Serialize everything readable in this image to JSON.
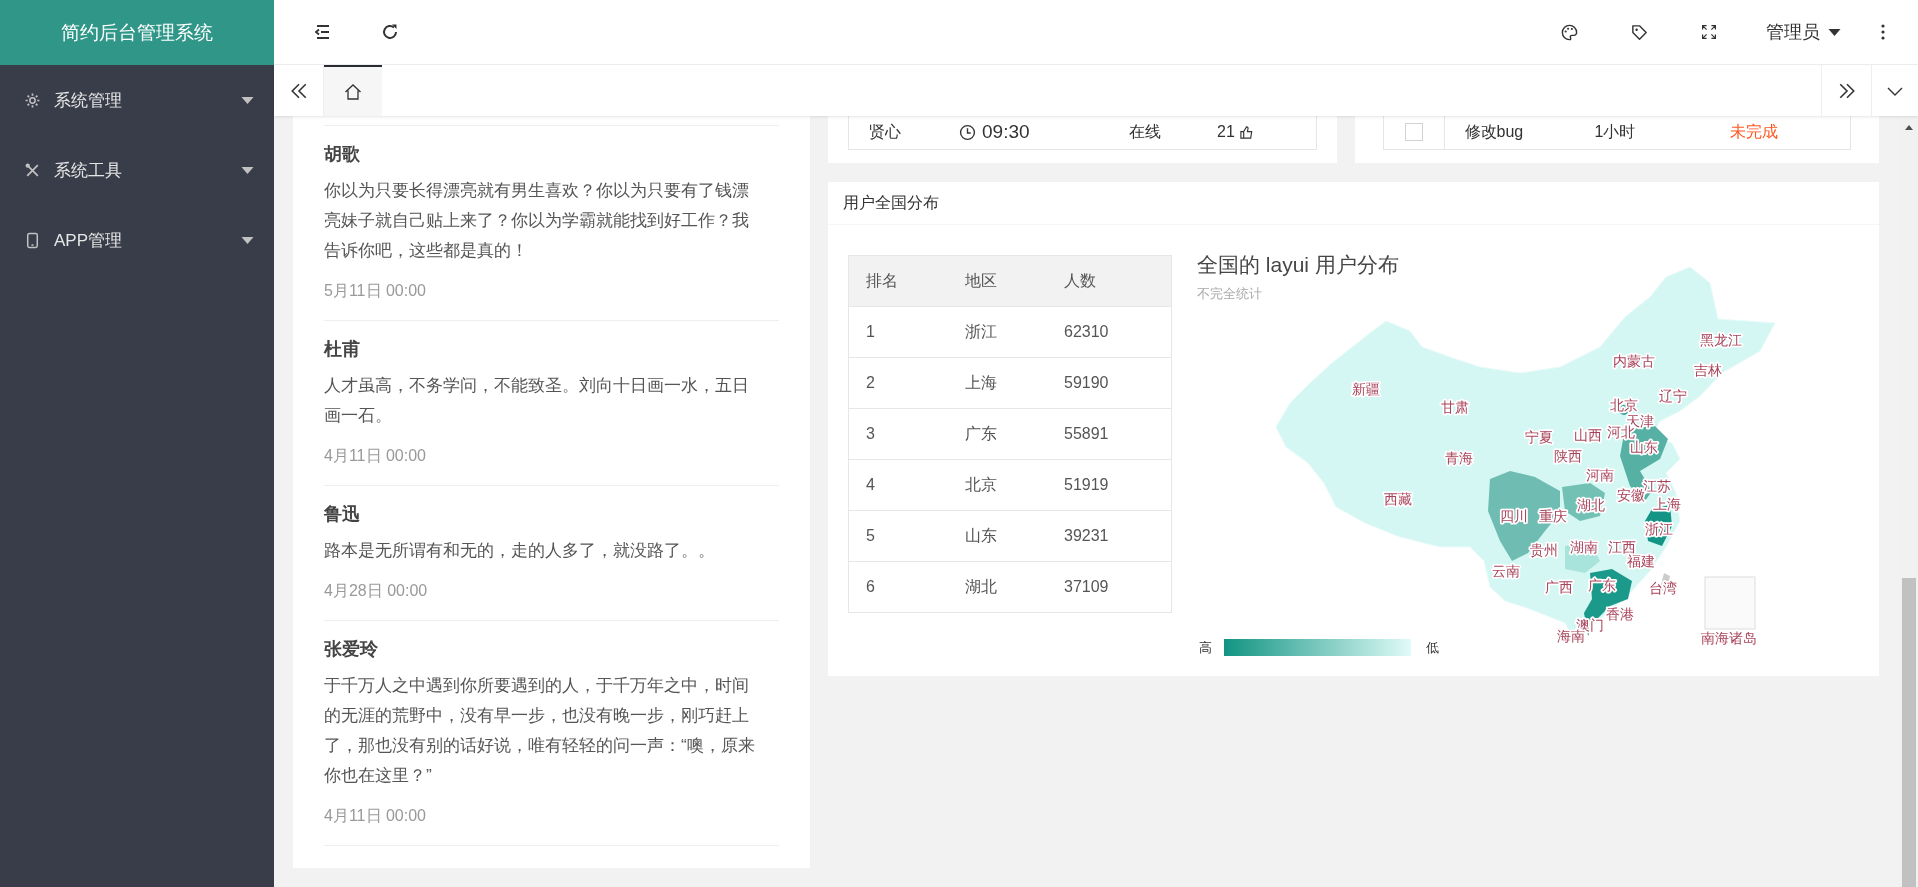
{
  "app": {
    "title": "简约后台管理系统"
  },
  "sidebar": {
    "items": [
      {
        "label": "系统管理",
        "expanded": false
      },
      {
        "label": "系统工具",
        "expanded": false
      },
      {
        "label": "APP管理",
        "expanded": false
      }
    ]
  },
  "header": {
    "user": "管理员"
  },
  "tabs": [
    {
      "kind": "home",
      "selected": true
    }
  ],
  "online_card": {
    "row": {
      "name": "贤心",
      "time": "09:30",
      "status": "在线",
      "count": "21"
    }
  },
  "todo_card": {
    "row": {
      "checked": false,
      "task": "修改bug",
      "duration": "1小时",
      "status": "未完成"
    }
  },
  "quotes": [
    {
      "author": "胡歌",
      "text": "你以为只要长得漂亮就有男生喜欢？你以为只要有了钱漂亮妹子就自己贴上来了？你以为学霸就能找到好工作？我告诉你吧，这些都是真的！",
      "date": "5月11日 00:00"
    },
    {
      "author": "杜甫",
      "text": "人才虽高，不务学问，不能致圣。刘向十日画一水，五日画一石。",
      "date": "4月11日 00:00"
    },
    {
      "author": "鲁迅",
      "text": "路本是无所谓有和无的，走的人多了，就没路了。。",
      "date": "4月28日 00:00"
    },
    {
      "author": "张爱玲",
      "text": "于千万人之中遇到你所要遇到的人，于千万年之中，时间的无涯的荒野中，没有早一步，也没有晚一步，刚巧赶上了，那也没有别的话好说，唯有轻轻的问一声：“噢，原来你也在这里？”",
      "date": "4月11日 00:00"
    }
  ],
  "distribution": {
    "title": "用户全国分布",
    "table": {
      "columns": [
        "排名",
        "地区",
        "人数"
      ],
      "rows": [
        [
          "1",
          "浙江",
          "62310"
        ],
        [
          "2",
          "上海",
          "59190"
        ],
        [
          "3",
          "广东",
          "55891"
        ],
        [
          "4",
          "北京",
          "51919"
        ],
        [
          "5",
          "山东",
          "39231"
        ],
        [
          "6",
          "湖北",
          "37109"
        ]
      ]
    },
    "map": {
      "title": "全国的 layui 用户分布",
      "subtitle": "不完全统计",
      "regions": [
        "黑龙江",
        "内蒙古",
        "吉林",
        "新疆",
        "甘肃",
        "北京",
        "辽宁",
        "天津",
        "宁夏",
        "山西",
        "河北",
        "山东",
        "青海",
        "陕西",
        "河南",
        "江苏",
        "西藏",
        "湖北",
        "安徽",
        "上海",
        "四川",
        "重庆",
        "浙江",
        "贵州",
        "湖南",
        "江西",
        "福建",
        "云南",
        "广西",
        "广东",
        "台湾",
        "香港",
        "澳门",
        "海南",
        "南海诸岛"
      ],
      "legend": {
        "high": "高",
        "low": "低"
      }
    }
  }
}
